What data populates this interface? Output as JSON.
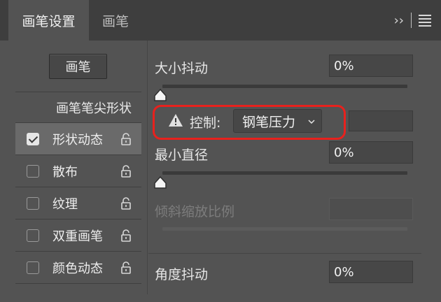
{
  "tabs": [
    {
      "label": "画笔设置",
      "active": true
    },
    {
      "label": "画笔",
      "active": false
    }
  ],
  "toolbar": {
    "expand_label": "››"
  },
  "left_panel": {
    "brush_button": "画笔",
    "tip_heading": "画笔笔尖形状",
    "options": [
      {
        "label": "形状动态",
        "checked": true,
        "selected": true
      },
      {
        "label": "散布",
        "checked": false,
        "selected": false
      },
      {
        "label": "纹理",
        "checked": false,
        "selected": false
      },
      {
        "label": "双重画笔",
        "checked": false,
        "selected": false
      },
      {
        "label": "颜色动态",
        "checked": false,
        "selected": false
      }
    ]
  },
  "right_panel": {
    "size_jitter": {
      "label": "大小抖动",
      "value": "0%",
      "slider": 0
    },
    "control": {
      "label": "控制:",
      "selected": "钢笔压力"
    },
    "min_diameter": {
      "label": "最小直径",
      "value": "0%",
      "slider": 0
    },
    "tilt_scale": {
      "label": "倾斜缩放比例",
      "value": "",
      "enabled": false
    },
    "angle_jitter": {
      "label": "角度抖动",
      "value": "0%"
    }
  },
  "colors": {
    "highlight": "#e8211d",
    "panel_bg": "#535353",
    "tab_bar_bg": "#3e3e3e"
  },
  "icons": [
    "lock-icon",
    "warning-icon",
    "chevron-down-icon",
    "panel-menu-icon",
    "expand-icon"
  ]
}
